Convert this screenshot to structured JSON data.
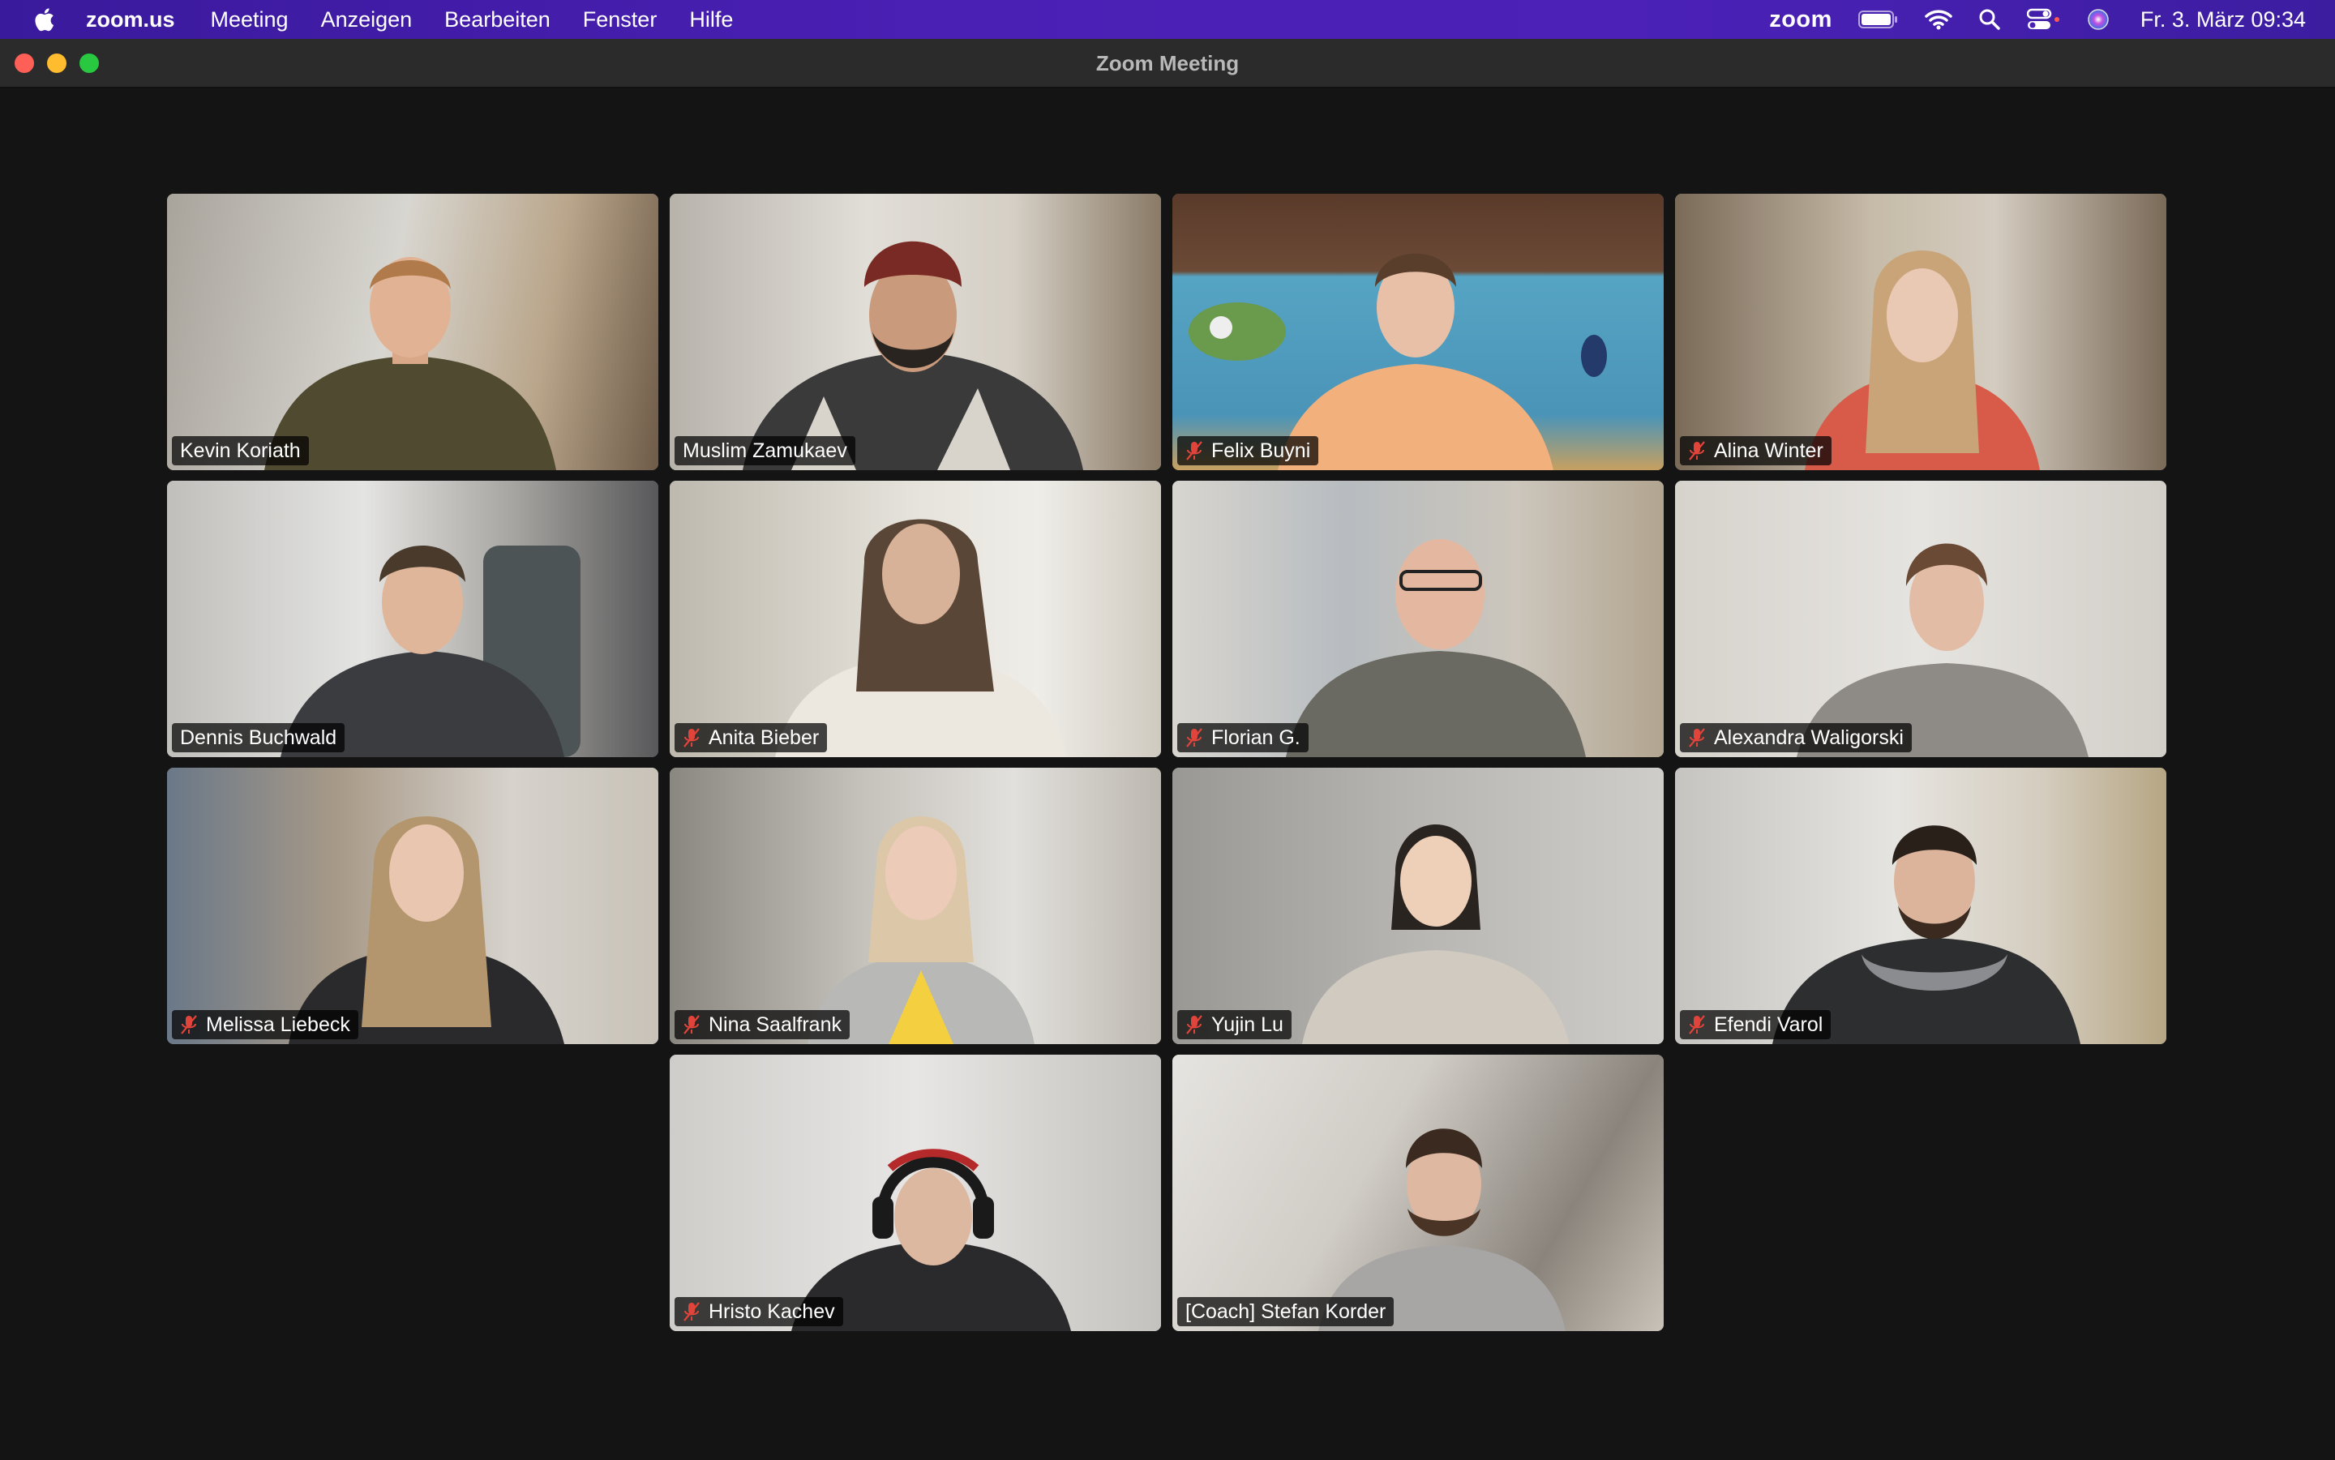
{
  "menubar": {
    "app": "zoom.us",
    "items": [
      "Meeting",
      "Anzeigen",
      "Bearbeiten",
      "Fenster",
      "Hilfe"
    ],
    "status_zoom": "zoom",
    "datetime": "Fr. 3. März 09:34"
  },
  "window": {
    "title": "Zoom Meeting"
  },
  "participants": [
    {
      "name": "Kevin Koriath",
      "muted": false,
      "active_speaker": false
    },
    {
      "name": "Muslim Zamukaev",
      "muted": false,
      "active_speaker": true
    },
    {
      "name": "Felix Buyni",
      "muted": true,
      "active_speaker": false
    },
    {
      "name": "Alina Winter",
      "muted": true,
      "active_speaker": false
    },
    {
      "name": "Dennis Buchwald",
      "muted": false,
      "active_speaker": false
    },
    {
      "name": "Anita Bieber",
      "muted": true,
      "active_speaker": false
    },
    {
      "name": "Florian G.",
      "muted": true,
      "active_speaker": false
    },
    {
      "name": "Alexandra Waligorski",
      "muted": true,
      "active_speaker": false
    },
    {
      "name": "Melissa Liebeck",
      "muted": true,
      "active_speaker": false
    },
    {
      "name": "Nina Saalfrank",
      "muted": true,
      "active_speaker": false
    },
    {
      "name": "Yujin Lu",
      "muted": true,
      "active_speaker": false
    },
    {
      "name": "Efendi Varol",
      "muted": true,
      "active_speaker": false
    },
    {
      "name": "Hristo Kachev",
      "muted": true,
      "active_speaker": false
    },
    {
      "name": "[Coach] Stefan Korder",
      "muted": false,
      "active_speaker": false
    }
  ],
  "colors": {
    "menubar": "#4a1fb4",
    "active_speaker_border": "#46d05c",
    "muted_icon": "#e0443a",
    "window_bg": "#141414"
  }
}
